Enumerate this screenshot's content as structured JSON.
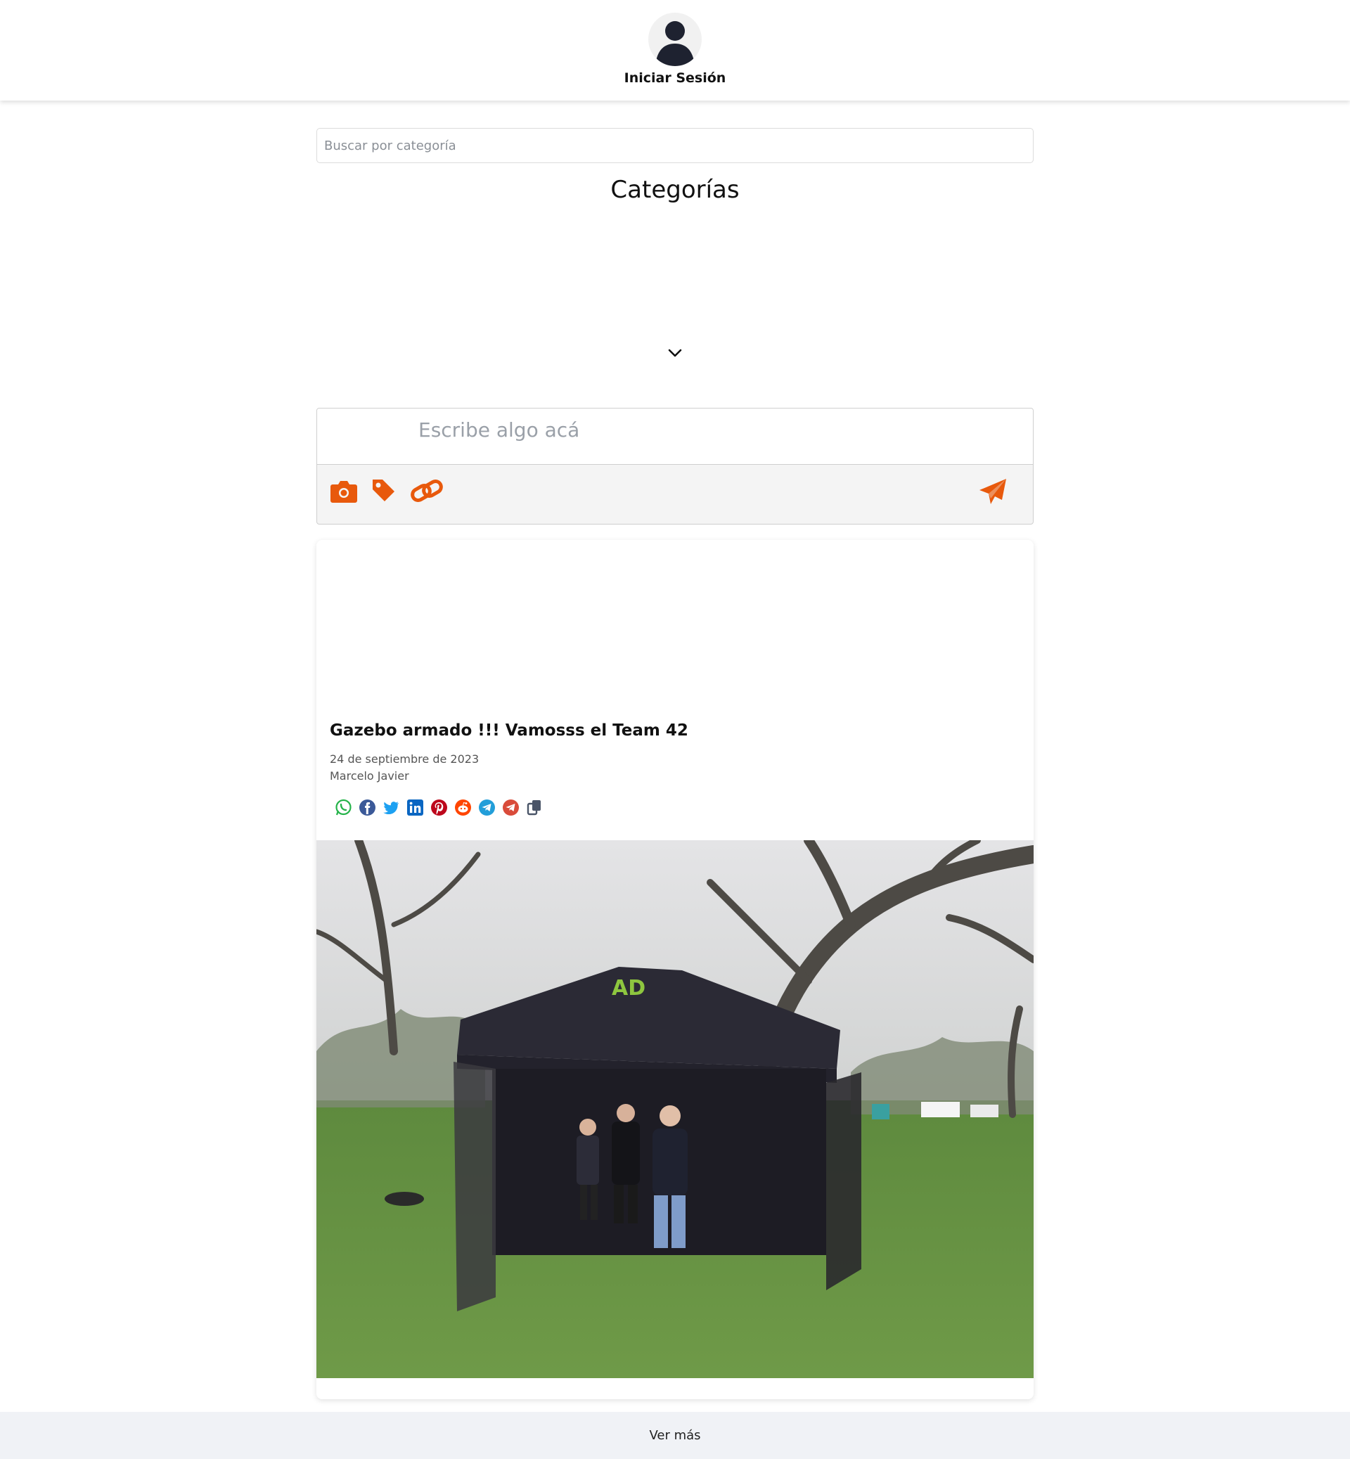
{
  "header": {
    "login_label": "Iniciar Sesión"
  },
  "search": {
    "placeholder": "Buscar por categoría"
  },
  "categories": {
    "title": "Categorías"
  },
  "composer": {
    "placeholder": "Escribe algo acá"
  },
  "post": {
    "title": "Gazebo armado !!! Vamosss el Team 42",
    "date": "24 de septiembre de 2023",
    "author": "Marcelo Javier",
    "share_icons": [
      "whatsapp-icon",
      "facebook-icon",
      "twitter-icon",
      "linkedin-icon",
      "pinterest-icon",
      "reddit-icon",
      "telegram-icon",
      "telegram-icon",
      "copy-icon"
    ]
  },
  "footer": {
    "more_label": "Ver más"
  },
  "colors": {
    "accent": "#e8590c",
    "header_bg": "#ffffff",
    "footer_bg": "#f0f2f6"
  }
}
